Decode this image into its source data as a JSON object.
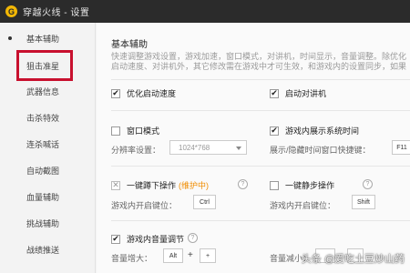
{
  "window": {
    "logo_glyph": "G",
    "title": "穿越火线 - 设置"
  },
  "sidebar": {
    "items": [
      {
        "label": "基本辅助"
      },
      {
        "label": "狙击准星"
      },
      {
        "label": "武器信息"
      },
      {
        "label": "击杀特效"
      },
      {
        "label": "连杀喊话"
      },
      {
        "label": "自动截图"
      },
      {
        "label": "血量辅助"
      },
      {
        "label": "挑战辅助"
      },
      {
        "label": "战绩推送"
      }
    ],
    "active_index": 0,
    "highlighted_index": 1,
    "highlight_color": "#c8102e"
  },
  "main": {
    "section_title": "基本辅助",
    "description": "快速调整游戏设置，游戏加速，窗口模式，对讲机，时间显示，音量调整。除优化启动速度、对讲机外，其它修改需在游戏中才可生效，和游戏内的设置同步，如果设置不能达到，请先登录游戏后还要退出登录的问题。",
    "options": {
      "optimize_startup": {
        "label": "优化启动速度",
        "checked": true
      },
      "walkie_talkie": {
        "label": "启动对讲机",
        "checked": true
      },
      "window_mode": {
        "label": "窗口模式",
        "checked": false
      },
      "show_time": {
        "label": "游戏内展示系统时间",
        "checked": true
      },
      "resolution_label": "分辨率设置：",
      "resolution_value": "1024*768",
      "time_hotkey_label": "展示/隐藏时间窗口快捷键：",
      "time_hotkey_value": "F11",
      "one_key_crouch": {
        "label": "一键蹲下操作",
        "badge": "(维护中)",
        "checked": false
      },
      "crouch_key_label": "游戏内开启键位：",
      "crouch_key_value": "Ctrl",
      "one_key_mute": {
        "label": "一键静步操作",
        "checked": false
      },
      "mute_key_label": "游戏内开启键位：",
      "mute_key_value": "Shift",
      "volume_adjust": {
        "label": "游戏内音量调节",
        "checked": true
      },
      "volume_up_label": "音量增大：",
      "volume_up_key1": "Alt",
      "volume_up_plus": "+",
      "volume_up_key2": "+",
      "volume_down_label": "音量减小："
    },
    "help_glyph": "?",
    "badge_color": "#f08c00"
  },
  "watermark": "头条 @爱吃土豆炒山药"
}
